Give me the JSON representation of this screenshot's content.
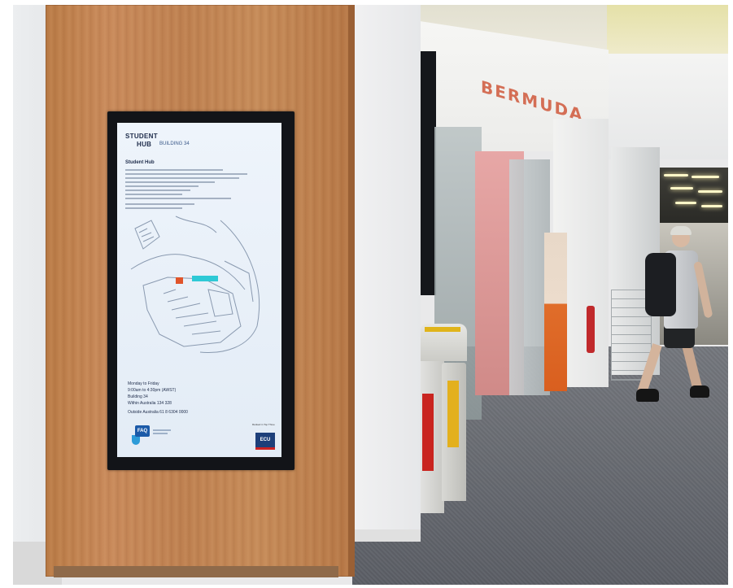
{
  "scene": {
    "description_colors": {
      "wood": "#c2844f",
      "screen_bg": "#e8f0f8",
      "bezel": "#121418",
      "sign_text": "#d46e55",
      "carpet": "#676a70"
    }
  },
  "screen": {
    "title_line1": "STUDENT",
    "title_line2": "HUB",
    "building": "BUILDING 34",
    "heading": "Student Hub",
    "hours": [
      "Monday to Friday",
      "9:00am to 4:30pm (AWST)",
      "Building 34",
      "Within Australia 134 328"
    ],
    "phone": "Outside Australia 61 8 6304 0000",
    "faq_label": "FAQ",
    "ecu_caption": "Ranked in Top Three",
    "ecu_logo": "ECU"
  },
  "storefront": {
    "sign": "BERMUDA"
  }
}
